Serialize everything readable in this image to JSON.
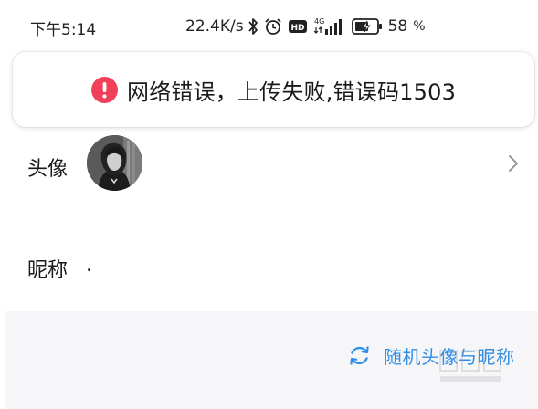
{
  "status_bar": {
    "time": "下午5:14",
    "net_speed": "22.4K/s",
    "network_type": "4G",
    "hd_badge": "HD",
    "battery_percent": "58",
    "battery_unit": "%",
    "icons": [
      "bluetooth-icon",
      "alarm-icon",
      "hd-icon",
      "signal-icon",
      "battery-charging-icon"
    ]
  },
  "toast": {
    "message": "网络错误，上传失败,错误码1503",
    "icon": "error-icon",
    "accent_color": "#f0405a"
  },
  "profile": {
    "avatar_label": "头像",
    "nickname_label": "昵称",
    "nickname_value": "."
  },
  "bottom": {
    "random_button_label": "随机头像与昵称",
    "accent_color": "#2f8fe8"
  }
}
